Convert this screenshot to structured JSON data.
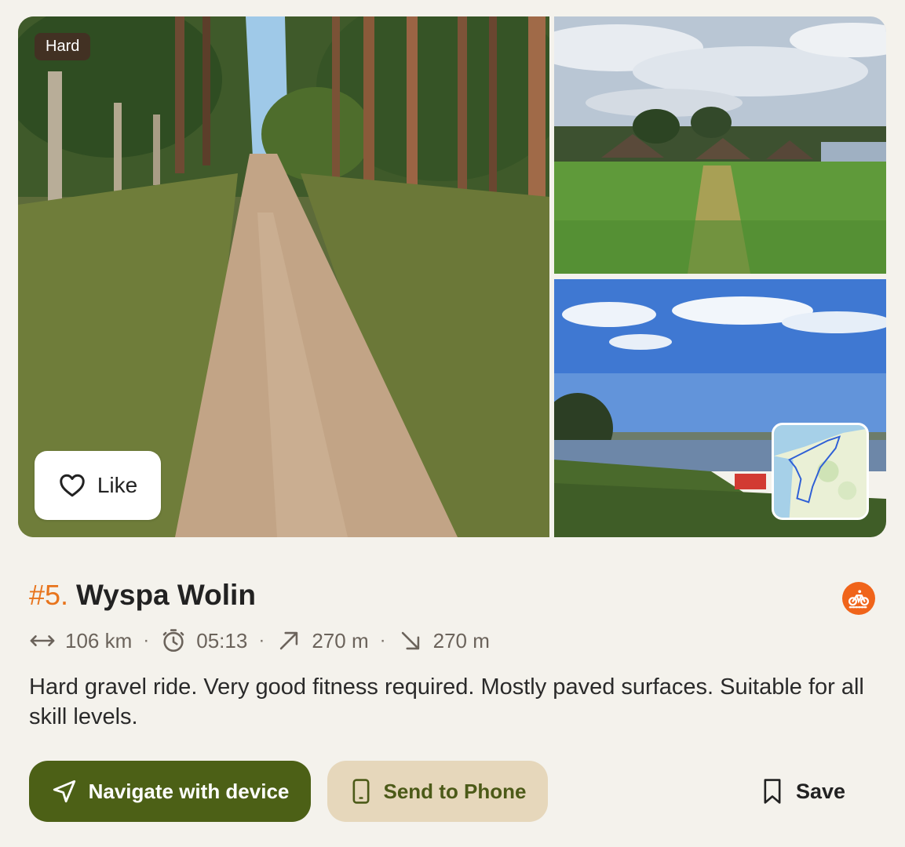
{
  "route": {
    "difficulty": "Hard",
    "rank": "#5.",
    "title": "Wyspa Wolin",
    "sport_icon": "bike-icon",
    "description": "Hard gravel ride. Very good fitness required. Mostly paved surfaces. Suitable for all skill levels."
  },
  "stats": {
    "distance": "106 km",
    "duration": "05:13",
    "elevation_up": "270 m",
    "elevation_down": "270 m",
    "separator": "·"
  },
  "actions": {
    "like_label": "Like",
    "navigate_label": "Navigate with device",
    "send_label": "Send to Phone",
    "save_label": "Save"
  },
  "colors": {
    "accent_orange": "#e8741c",
    "primary_green": "#4c6016",
    "secondary_beige": "#e6d7bb",
    "background": "#f4f2ec"
  }
}
